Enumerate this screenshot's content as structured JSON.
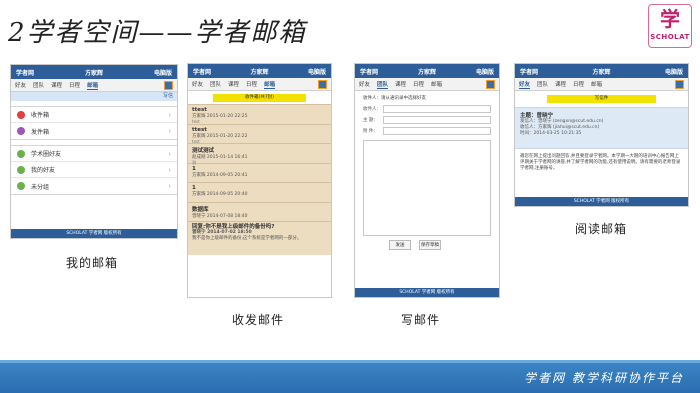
{
  "slide": {
    "title": "2学者空间——学者邮箱",
    "logo_glyph": "学",
    "logo_sub": "SCHOLAT"
  },
  "screens": {
    "inbox": {
      "app_name": "学者网",
      "user_name": "方家辉",
      "right_label": "电脑版",
      "tabs": [
        "好友",
        "团队",
        "课程",
        "日程",
        "邮箱"
      ],
      "strip_text": "写信",
      "folders": [
        {
          "label": "收件箱",
          "icon": "inbox-icon",
          "color": "#e04040"
        },
        {
          "label": "发件箱",
          "icon": "outbox-icon",
          "color": "#9b59b6"
        }
      ],
      "contacts": [
        {
          "label": "学术圈好友",
          "icon": "contacts-icon",
          "color": "#6ab04c"
        },
        {
          "label": "我的好友",
          "icon": "friends-icon",
          "color": "#6ab04c"
        },
        {
          "label": "未分组",
          "icon": "ungrouped-icon",
          "color": "#6ab04c"
        }
      ],
      "footer": "SCHOLAT 学者网 版权所有"
    },
    "mail_list": {
      "app_name": "学者网",
      "user_name": "方家辉",
      "right_label": "电脑版",
      "tabs": [
        "好友",
        "团队",
        "课程",
        "日程",
        "邮箱"
      ],
      "banner": "收件箱(共7封)",
      "items": [
        {
          "title": "ttest",
          "meta": "方家辉 2015-01-20 22:25",
          "extra": "test"
        },
        {
          "title": "ttest",
          "meta": "方家辉 2015-01-20 22:22",
          "extra": "test"
        },
        {
          "title": "测试测试",
          "meta": "赵成刚 2015-01-14 16:41",
          "extra": "测"
        },
        {
          "title": "1",
          "meta": "方家辉 2014-09-05 20:41",
          "extra": ""
        },
        {
          "title": "1",
          "meta": "方家辉 2014-09-05 20:40",
          "extra": ""
        },
        {
          "title": "数据库",
          "meta": "曾晓宁 2014-07-08 18:40",
          "extra": ""
        }
      ],
      "last_item": {
        "title": "回复:你不是我上级邮件的备份吗?",
        "meta": "曾晓宁 2014-07-02 18:50",
        "extra": "我不是你上级邮件的备份,这个系统是学者网的一部分。"
      },
      "footer": "SCHOLAT 学者网"
    },
    "compose": {
      "app_name": "学者网",
      "user_name": "方家辉",
      "right_label": "电脑版",
      "tabs": [
        "好友",
        "团队",
        "课程",
        "日程",
        "邮箱"
      ],
      "top_text": "收件人：请从通讯录中选择好友",
      "fields": [
        "收件人：",
        "主 题：",
        "附 件："
      ],
      "buttons": [
        "发送",
        "保存草稿"
      ],
      "footer": "SCHOLAT 学者网 版权所有"
    },
    "read": {
      "app_name": "学者网",
      "user_name": "方家辉",
      "right_label": "电脑版",
      "tabs": [
        "好友",
        "团队",
        "课程",
        "日程",
        "邮箱"
      ],
      "yellow": "写信件",
      "subject": "主题：曾晓宁",
      "from": "发信人：曾晓宁 (zengxn@scut.edu.cn)",
      "to": "收信人：方家辉 (jiahui@scut.edu.cn)",
      "time": "时间：2014-03-25 10:21:35",
      "body": "邀您在网上提出问题回答,并且要登录学者网。本学期一大期的培训中心报告网上评期关于学者网的讲座,并了解学者网的功能,还有使用说明。请有需要的老师登录学者网,注册账号。",
      "footer": "SCHOLAT 学者网 版权所有"
    }
  },
  "captions": {
    "inbox": "我的邮箱",
    "mail_list": "收发邮件",
    "compose": "写邮件",
    "read": "阅读邮箱"
  },
  "footer": {
    "slogan": "学者网 教学科研协作平台"
  }
}
